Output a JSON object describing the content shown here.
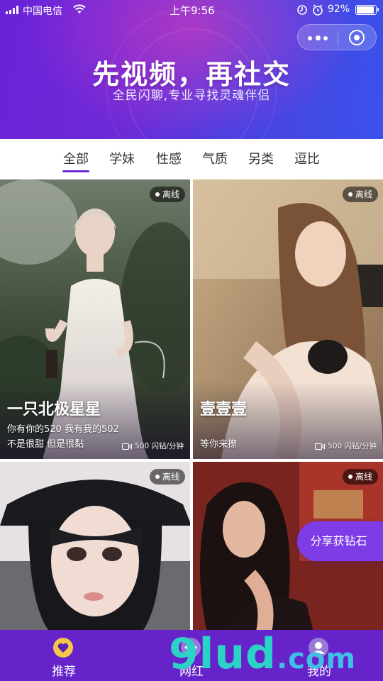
{
  "status_bar": {
    "carrier": "中国电信",
    "time": "上午9:56",
    "battery": "92%",
    "battery_level": 0.92
  },
  "banner": {
    "headline": "先视频，再社交",
    "subhead": "全民闪聊,专业寻找灵魂伴侣"
  },
  "tabs": [
    {
      "label": "全部",
      "active": true
    },
    {
      "label": "学妹",
      "active": false
    },
    {
      "label": "性感",
      "active": false
    },
    {
      "label": "气质",
      "active": false
    },
    {
      "label": "另类",
      "active": false
    },
    {
      "label": "逗比",
      "active": false
    }
  ],
  "cards": [
    {
      "status": "离线",
      "name": "一只北极星星",
      "bio": "你有你的520 我有我的502 不是很甜 但是很黏",
      "price": "500 闪钻/分钟"
    },
    {
      "status": "离线",
      "name": "壹壹壹",
      "bio": "等你来撩",
      "price": "500 闪钻/分钟"
    },
    {
      "status": "离线"
    },
    {
      "status": "离线"
    }
  ],
  "share_button": "分享获钻石",
  "bottom_nav": [
    {
      "label": "推荐",
      "icon": "heart-icon"
    },
    {
      "label": "网红",
      "icon": "lips-icon"
    },
    {
      "label": "我的",
      "icon": "user-icon"
    }
  ],
  "watermark": {
    "main": "9lud",
    "suffix": ".com"
  },
  "colors": {
    "accent": "#6e2ad8",
    "nav_bg": "#6523c9",
    "share_bg": "#7d3ce6"
  }
}
